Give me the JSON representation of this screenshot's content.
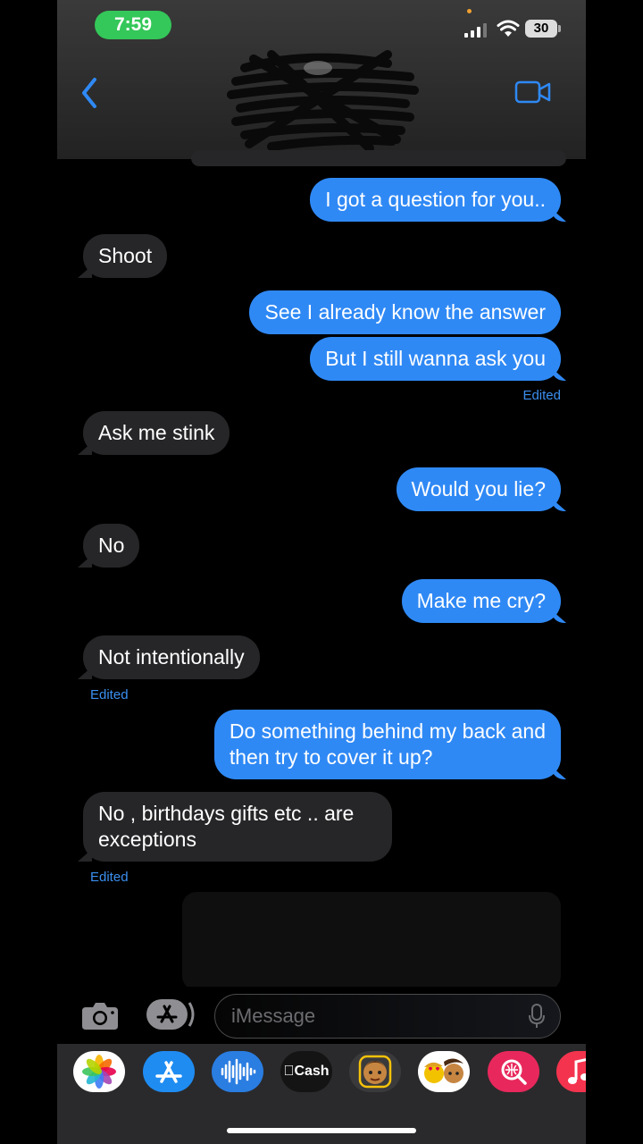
{
  "status_bar": {
    "time": "7:59",
    "battery": "30"
  },
  "header": {
    "back_icon": "chevron-left-icon",
    "video_icon": "video-camera-icon",
    "contact_name_redacted": true
  },
  "messages": [
    {
      "dir": "sent",
      "text": "I got a question for you..",
      "edited": false
    },
    {
      "dir": "recv",
      "text": "Shoot",
      "edited": false
    },
    {
      "dir": "sent",
      "text": "See I already know the answer",
      "edited": false
    },
    {
      "dir": "sent",
      "text": "But I still wanna ask you",
      "edited": true
    },
    {
      "dir": "recv",
      "text": "Ask me stink",
      "edited": false
    },
    {
      "dir": "sent",
      "text": "Would you lie?",
      "edited": false
    },
    {
      "dir": "recv",
      "text": "No",
      "edited": false
    },
    {
      "dir": "sent",
      "text": "Make me cry?",
      "edited": false
    },
    {
      "dir": "recv",
      "text": "Not intentionally",
      "edited": true
    },
    {
      "dir": "sent",
      "text": "Do something behind my back and\nthen try to cover it up?",
      "edited": false
    },
    {
      "dir": "recv",
      "text": "No , birthdays gifts etc .. are\nexceptions",
      "edited": true
    }
  ],
  "edited_label": "Edited",
  "compose": {
    "placeholder": "iMessage"
  },
  "app_drawer": {
    "apps": [
      "photos-icon",
      "app-store-icon",
      "audio-message-icon",
      "apple-cash-icon",
      "memoji-icon",
      "memoji-stickers-icon",
      "image-search-icon",
      "music-icon"
    ],
    "cash_label": "Cash"
  },
  "colors": {
    "sent_bubble": "#2f89f5",
    "received_bubble": "#262628",
    "time_pill": "#34c759",
    "edited_text": "#3b8ff0"
  }
}
